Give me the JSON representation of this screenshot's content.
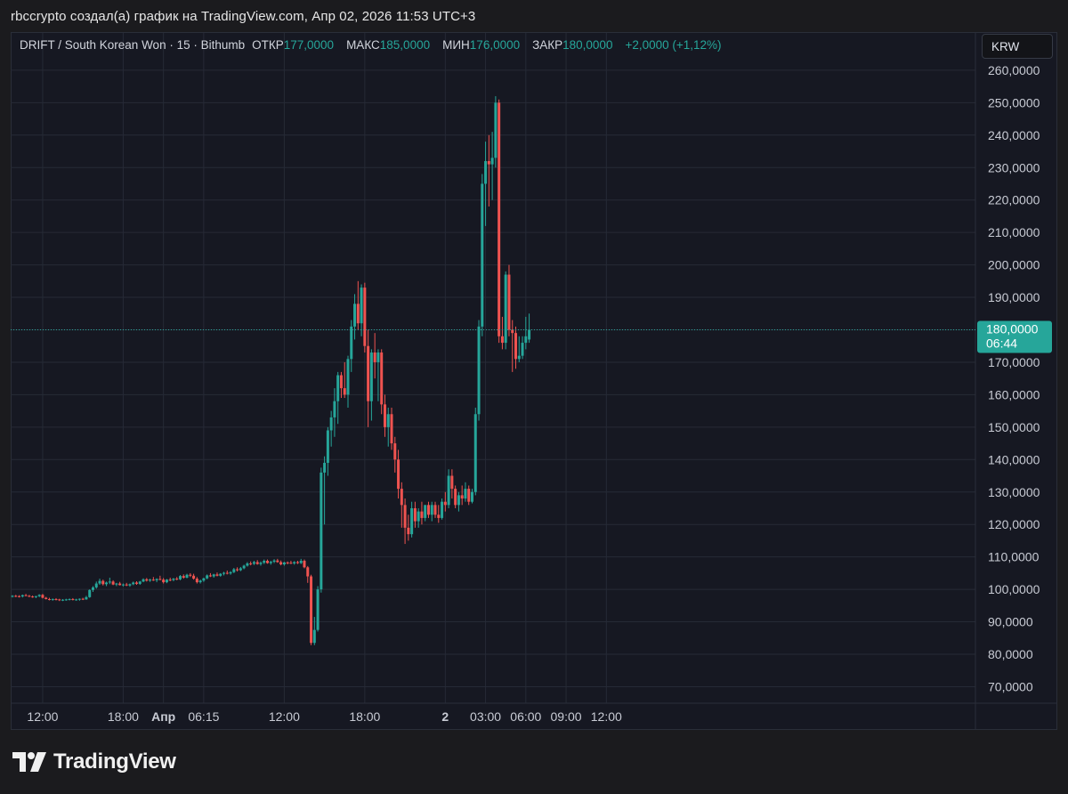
{
  "caption": "rbccrypto создал(а) график на TradingView.com, Апр 02, 2026 11:53 UTC+3",
  "legend": {
    "symbol": "DRIFT / South Korean Won · 15 · Bithumb",
    "open_label": "ОТКР",
    "open_value": "177,0000",
    "high_label": "МАКС",
    "high_value": "185,0000",
    "low_label": "МИН",
    "low_value": "176,0000",
    "close_label": "ЗАКР",
    "close_value": "180,0000",
    "change": "+2,0000 (+1,12%)"
  },
  "currency_button": "KRW",
  "brand": "TradingView",
  "colors": {
    "up": "#26a69a",
    "down": "#ef5350",
    "background": "#161822",
    "grid": "#262a36"
  },
  "chart_data": {
    "type": "candlestick",
    "ylim": [
      65,
      265
    ],
    "y_ticks": [
      "70,0000",
      "80,0000",
      "90,0000",
      "100,0000",
      "110,0000",
      "120,0000",
      "130,0000",
      "140,0000",
      "150,0000",
      "160,0000",
      "170,0000",
      "180,0000",
      "190,0000",
      "200,0000",
      "210,0000",
      "220,0000",
      "230,0000",
      "240,0000",
      "250,0000",
      "260,0000"
    ],
    "y_tick_values": [
      70,
      80,
      90,
      100,
      110,
      120,
      130,
      140,
      150,
      160,
      170,
      180,
      190,
      200,
      210,
      220,
      230,
      240,
      250,
      260
    ],
    "x_ticks": [
      {
        "label": "12:00",
        "t": 9,
        "bold": false
      },
      {
        "label": "18:00",
        "t": 33,
        "bold": false
      },
      {
        "label": "Апр",
        "t": 45,
        "bold": true
      },
      {
        "label": "06:15",
        "t": 57,
        "bold": false
      },
      {
        "label": "12:00",
        "t": 81,
        "bold": false
      },
      {
        "label": "18:00",
        "t": 105,
        "bold": false
      },
      {
        "label": "2",
        "t": 129,
        "bold": true
      },
      {
        "label": "03:00",
        "t": 141,
        "bold": false
      },
      {
        "label": "06:00",
        "t": 153,
        "bold": false
      },
      {
        "label": "09:00",
        "t": 165,
        "bold": false
      },
      {
        "label": "12:00",
        "t": 177,
        "bold": false
      }
    ],
    "last_price": {
      "value": 180,
      "label": "180,0000",
      "countdown": "06:44"
    },
    "ohlc": [
      [
        97.8,
        98.2,
        97.5,
        98.0
      ],
      [
        98.0,
        98.3,
        97.6,
        97.9
      ],
      [
        97.9,
        98.2,
        97.5,
        97.8
      ],
      [
        97.8,
        98.4,
        97.5,
        98.2
      ],
      [
        98.2,
        98.6,
        97.9,
        98.0
      ],
      [
        98.0,
        98.3,
        97.6,
        97.8
      ],
      [
        97.8,
        98.1,
        97.4,
        97.6
      ],
      [
        97.6,
        98.0,
        97.3,
        97.9
      ],
      [
        97.9,
        98.5,
        97.6,
        98.3
      ],
      [
        98.3,
        98.6,
        97.2,
        97.4
      ],
      [
        97.4,
        97.7,
        96.9,
        97.0
      ],
      [
        97.0,
        97.4,
        96.6,
        96.8
      ],
      [
        96.8,
        97.2,
        96.5,
        97.0
      ],
      [
        97.0,
        97.3,
        96.6,
        96.9
      ],
      [
        96.9,
        97.1,
        96.4,
        96.7
      ],
      [
        96.7,
        97.0,
        96.4,
        96.8
      ],
      [
        96.8,
        97.1,
        96.5,
        96.9
      ],
      [
        96.9,
        97.2,
        96.6,
        97.0
      ],
      [
        97.0,
        97.3,
        96.6,
        96.8
      ],
      [
        96.8,
        97.1,
        96.5,
        96.9
      ],
      [
        96.9,
        97.2,
        96.5,
        97.1
      ],
      [
        97.1,
        97.4,
        96.7,
        96.9
      ],
      [
        96.9,
        98.0,
        96.8,
        97.6
      ],
      [
        97.6,
        100.0,
        97.4,
        99.8
      ],
      [
        99.8,
        101.0,
        99.2,
        100.6
      ],
      [
        100.6,
        102.4,
        100.2,
        101.8
      ],
      [
        101.8,
        103.3,
        101.4,
        102.6
      ],
      [
        102.6,
        103.0,
        101.2,
        101.6
      ],
      [
        101.6,
        102.4,
        101.0,
        102.1
      ],
      [
        102.1,
        103.6,
        101.6,
        102.4
      ],
      [
        102.4,
        102.8,
        101.3,
        101.5
      ],
      [
        101.5,
        102.0,
        101.0,
        101.8
      ],
      [
        101.8,
        102.3,
        101.2,
        101.3
      ],
      [
        101.3,
        101.8,
        100.9,
        101.5
      ],
      [
        101.5,
        102.0,
        101.0,
        101.2
      ],
      [
        101.2,
        101.8,
        100.8,
        101.6
      ],
      [
        101.6,
        102.4,
        101.3,
        102.1
      ],
      [
        102.1,
        102.5,
        101.4,
        101.7
      ],
      [
        101.7,
        102.6,
        101.4,
        102.4
      ],
      [
        102.4,
        103.4,
        102.2,
        103.1
      ],
      [
        103.1,
        103.5,
        102.4,
        102.7
      ],
      [
        102.7,
        103.3,
        102.3,
        103.0
      ],
      [
        103.0,
        103.8,
        102.6,
        102.8
      ],
      [
        102.8,
        103.4,
        102.2,
        103.2
      ],
      [
        103.2,
        104.2,
        102.8,
        103.0
      ],
      [
        103.0,
        103.5,
        101.8,
        102.2
      ],
      [
        102.2,
        103.2,
        101.9,
        103.0
      ],
      [
        103.0,
        103.6,
        102.5,
        102.9
      ],
      [
        102.9,
        103.5,
        102.5,
        103.3
      ],
      [
        103.3,
        103.8,
        102.8,
        103.1
      ],
      [
        103.1,
        104.4,
        102.8,
        104.1
      ],
      [
        104.1,
        104.6,
        103.3,
        103.6
      ],
      [
        103.6,
        104.8,
        103.4,
        104.5
      ],
      [
        104.5,
        105.0,
        103.8,
        104.2
      ],
      [
        104.2,
        104.8,
        103.0,
        103.3
      ],
      [
        103.3,
        103.8,
        101.8,
        102.2
      ],
      [
        102.2,
        103.0,
        101.8,
        102.7
      ],
      [
        102.7,
        103.6,
        102.3,
        103.4
      ],
      [
        103.4,
        104.6,
        103.1,
        104.3
      ],
      [
        104.3,
        105.0,
        103.8,
        104.0
      ],
      [
        104.0,
        104.8,
        103.6,
        104.6
      ],
      [
        104.6,
        105.2,
        104.0,
        104.2
      ],
      [
        104.2,
        105.0,
        103.9,
        104.8
      ],
      [
        104.8,
        105.4,
        104.3,
        105.1
      ],
      [
        105.1,
        105.8,
        104.6,
        104.9
      ],
      [
        104.9,
        105.6,
        104.5,
        105.3
      ],
      [
        105.3,
        106.6,
        105.0,
        106.2
      ],
      [
        106.2,
        106.8,
        105.5,
        105.9
      ],
      [
        105.9,
        106.9,
        105.6,
        106.5
      ],
      [
        106.5,
        107.6,
        106.2,
        107.3
      ],
      [
        107.3,
        108.4,
        107.0,
        108.0
      ],
      [
        108.0,
        108.6,
        107.4,
        107.9
      ],
      [
        107.9,
        108.8,
        107.5,
        108.4
      ],
      [
        108.4,
        109.0,
        107.6,
        107.8
      ],
      [
        107.8,
        108.6,
        107.3,
        108.2
      ],
      [
        108.2,
        109.2,
        107.8,
        108.8
      ],
      [
        108.8,
        109.2,
        107.9,
        108.1
      ],
      [
        108.1,
        108.8,
        107.6,
        108.5
      ],
      [
        108.5,
        109.3,
        108.1,
        108.9
      ],
      [
        108.9,
        109.4,
        108.2,
        108.4
      ],
      [
        108.4,
        108.9,
        107.4,
        107.7
      ],
      [
        107.7,
        108.5,
        107.3,
        108.3
      ],
      [
        108.3,
        108.6,
        107.7,
        108.2
      ],
      [
        108.2,
        108.8,
        107.8,
        108.0
      ],
      [
        108.0,
        108.7,
        107.6,
        108.4
      ],
      [
        108.4,
        108.8,
        107.8,
        108.1
      ],
      [
        108.1,
        109.4,
        107.8,
        108.8
      ],
      [
        108.8,
        109.2,
        106.5,
        106.8
      ],
      [
        106.8,
        107.2,
        102.0,
        104.0
      ],
      [
        104.0,
        104.5,
        82.8,
        83.5
      ],
      [
        83.5,
        91.5,
        82.8,
        87.5
      ],
      [
        87.5,
        101.0,
        87.0,
        100.0
      ],
      [
        100.0,
        137.5,
        99.0,
        136.0
      ],
      [
        136.0,
        141.0,
        120.0,
        139.0
      ],
      [
        139.0,
        150.0,
        135.0,
        149.0
      ],
      [
        149.0,
        155.0,
        144.0,
        153.0
      ],
      [
        153.0,
        162.0,
        147.0,
        158.0
      ],
      [
        158.0,
        167.0,
        151.0,
        166.0
      ],
      [
        166.0,
        167.0,
        159.0,
        162.0
      ],
      [
        162.0,
        170.0,
        159.0,
        160.0
      ],
      [
        160.0,
        172.0,
        156.0,
        171.0
      ],
      [
        171.0,
        183.0,
        167.0,
        181.0
      ],
      [
        181.0,
        191.0,
        177.0,
        188.0
      ],
      [
        188.0,
        195.0,
        180.0,
        182.0
      ],
      [
        182.0,
        194.0,
        178.0,
        193.0
      ],
      [
        193.0,
        194.5,
        173.0,
        175.0
      ],
      [
        175.0,
        180.0,
        150.0,
        158.0
      ],
      [
        158.0,
        174.0,
        152.0,
        173.0
      ],
      [
        173.0,
        179.0,
        165.0,
        170.0
      ],
      [
        170.0,
        174.0,
        158.0,
        173.0
      ],
      [
        173.0,
        174.0,
        154.0,
        157.0
      ],
      [
        157.0,
        160.0,
        147.0,
        150.0
      ],
      [
        150.0,
        156.0,
        144.0,
        154.0
      ],
      [
        154.0,
        156.0,
        143.0,
        145.0
      ],
      [
        145.0,
        147.0,
        136.0,
        140.0
      ],
      [
        140.0,
        143.0,
        128.0,
        131.0
      ],
      [
        131.0,
        133.0,
        119.0,
        126.0
      ],
      [
        126.0,
        128.0,
        114.0,
        119.0
      ],
      [
        119.0,
        123.0,
        115.0,
        117.0
      ],
      [
        117.0,
        127.0,
        116.0,
        125.0
      ],
      [
        125.0,
        127.0,
        119.0,
        121.0
      ],
      [
        121.0,
        125.0,
        119.0,
        124.0
      ],
      [
        124.0,
        127.0,
        120.0,
        122.0
      ],
      [
        122.0,
        126.0,
        121.0,
        126.0
      ],
      [
        126.0,
        127.0,
        122.0,
        123.0
      ],
      [
        123.0,
        127.0,
        121.0,
        126.0
      ],
      [
        126.0,
        127.0,
        122.0,
        123.0
      ],
      [
        123.0,
        126.0,
        120.5,
        122.0
      ],
      [
        122.0,
        128.0,
        121.5,
        127.0
      ],
      [
        127.0,
        130.0,
        124.0,
        126.0
      ],
      [
        126.0,
        137.0,
        125.0,
        135.0
      ],
      [
        135.0,
        137.0,
        128.0,
        131.0
      ],
      [
        131.0,
        132.0,
        125.0,
        126.0
      ],
      [
        126.0,
        130.0,
        124.0,
        129.0
      ],
      [
        129.0,
        132.0,
        126.0,
        128.0
      ],
      [
        128.0,
        133.0,
        127.0,
        131.0
      ],
      [
        131.0,
        132.0,
        126.0,
        127.0
      ],
      [
        127.0,
        131.0,
        126.5,
        130.0
      ],
      [
        130.0,
        156.0,
        129.0,
        154.0
      ],
      [
        154.0,
        183.0,
        152.0,
        181.0
      ],
      [
        181.0,
        228.0,
        178.0,
        225.0
      ],
      [
        225.0,
        238.0,
        212.0,
        232.0
      ],
      [
        232.0,
        240.0,
        218.0,
        231.0
      ],
      [
        231.0,
        241.0,
        220.0,
        233.0
      ],
      [
        233.0,
        252.0,
        230.0,
        250.0
      ],
      [
        250.0,
        251.0,
        176.0,
        178.0
      ],
      [
        178.0,
        184.0,
        174.0,
        176.0
      ],
      [
        176.0,
        198.0,
        174.0,
        197.0
      ],
      [
        197.0,
        200.0,
        178.0,
        180.0
      ],
      [
        180.0,
        183.0,
        167.0,
        179.0
      ],
      [
        179.0,
        181.0,
        168.0,
        171.0
      ],
      [
        171.0,
        178.0,
        170.0,
        172.0
      ],
      [
        172.0,
        178.0,
        171.0,
        176.0
      ],
      [
        176.0,
        184.0,
        174.0,
        178.0
      ],
      [
        177.0,
        185.0,
        176.0,
        180.0
      ]
    ]
  }
}
